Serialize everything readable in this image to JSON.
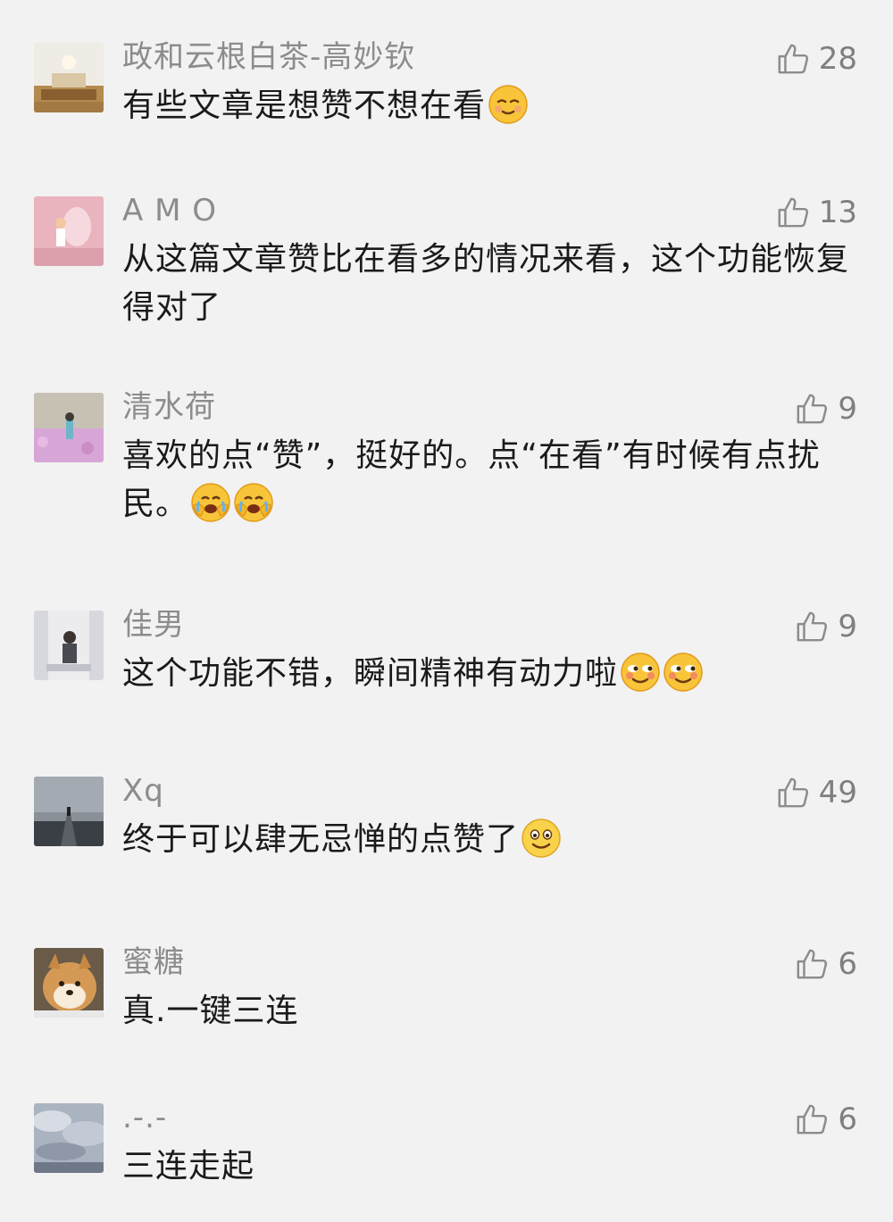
{
  "comments": [
    {
      "nickname": "政和云根白茶-高妙钦",
      "likes": "28",
      "text": "有些文章是想赞不想在看",
      "emojis": [
        "relieved-face-emoji"
      ],
      "avatar_colors": [
        "#f3f0ea",
        "#b9905a"
      ]
    },
    {
      "nickname": "A M O",
      "likes": "13",
      "text": "从这篇文章赞比在看多的情况来看，这个功能恢复得对了",
      "emojis": [],
      "avatar_colors": [
        "#e9b7c0",
        "#d89aa6"
      ]
    },
    {
      "nickname": "清水荷",
      "likes": "9",
      "text": "喜欢的点“赞”，挺好的。点“在看”有时候有点扰民。",
      "emojis": [
        "facepalm-laugh-emoji",
        "facepalm-laugh-emoji"
      ],
      "avatar_colors": [
        "#c9c5d6",
        "#d9a8cf"
      ]
    },
    {
      "nickname": "佳男",
      "likes": "9",
      "text": "这个功能不错，瞬间精神有动力啦",
      "emojis": [
        "smirk-blush-emoji",
        "smirk-blush-emoji"
      ],
      "avatar_colors": [
        "#eeeef0",
        "#9a9da6"
      ]
    },
    {
      "nickname": "Xq",
      "likes": "49",
      "text": "终于可以肆无忌惮的点赞了",
      "emojis": [
        "smile-emoji"
      ],
      "avatar_colors": [
        "#6c7178",
        "#3a3e44"
      ]
    },
    {
      "nickname": "蜜糖",
      "likes": "6",
      "text": "真.一键三连",
      "emojis": [],
      "avatar_colors": [
        "#d9a15c",
        "#f5e6d0"
      ]
    },
    {
      "nickname": ".-.-",
      "likes": "6",
      "text": "三连走起",
      "emojis": [],
      "avatar_colors": [
        "#9aa4b2",
        "#d6dbe2"
      ]
    }
  ],
  "icons": {
    "like": "thumbs-up-outline-icon"
  },
  "colors": {
    "background": "#f2f2f2",
    "nickname": "#8c8c8c",
    "text": "#1a1a1a"
  }
}
